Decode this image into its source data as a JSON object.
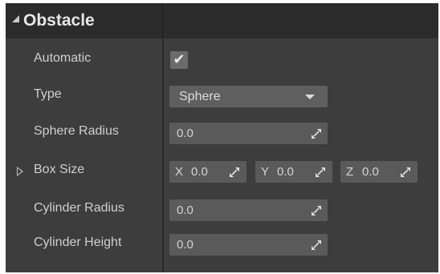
{
  "section": {
    "title": "Obstacle"
  },
  "rows": {
    "automatic": {
      "label": "Automatic",
      "checked": true,
      "check_glyph": "✔"
    },
    "type": {
      "label": "Type",
      "value": "Sphere",
      "icon": "dropdown-caret-icon"
    },
    "sphere_radius": {
      "label": "Sphere Radius",
      "value": "0.0"
    },
    "box_size": {
      "label": "Box Size",
      "x_axis": "X",
      "x_value": "0.0",
      "y_axis": "Y",
      "y_value": "0.0",
      "z_axis": "Z",
      "z_value": "0.0"
    },
    "cylinder_radius": {
      "label": "Cylinder Radius",
      "value": "0.0"
    },
    "cylinder_height": {
      "label": "Cylinder Height",
      "value": "0.0"
    }
  },
  "icons": {
    "collapse": "collapse-arrow-icon",
    "expand": "expand-arrow-icon",
    "drag": "drag-value-icon"
  },
  "colors": {
    "panel_bg": "#3d3d3d",
    "header_bg": "#2b2b2b",
    "field_bg": "#5a5a5a",
    "text": "#d0d0d0"
  }
}
